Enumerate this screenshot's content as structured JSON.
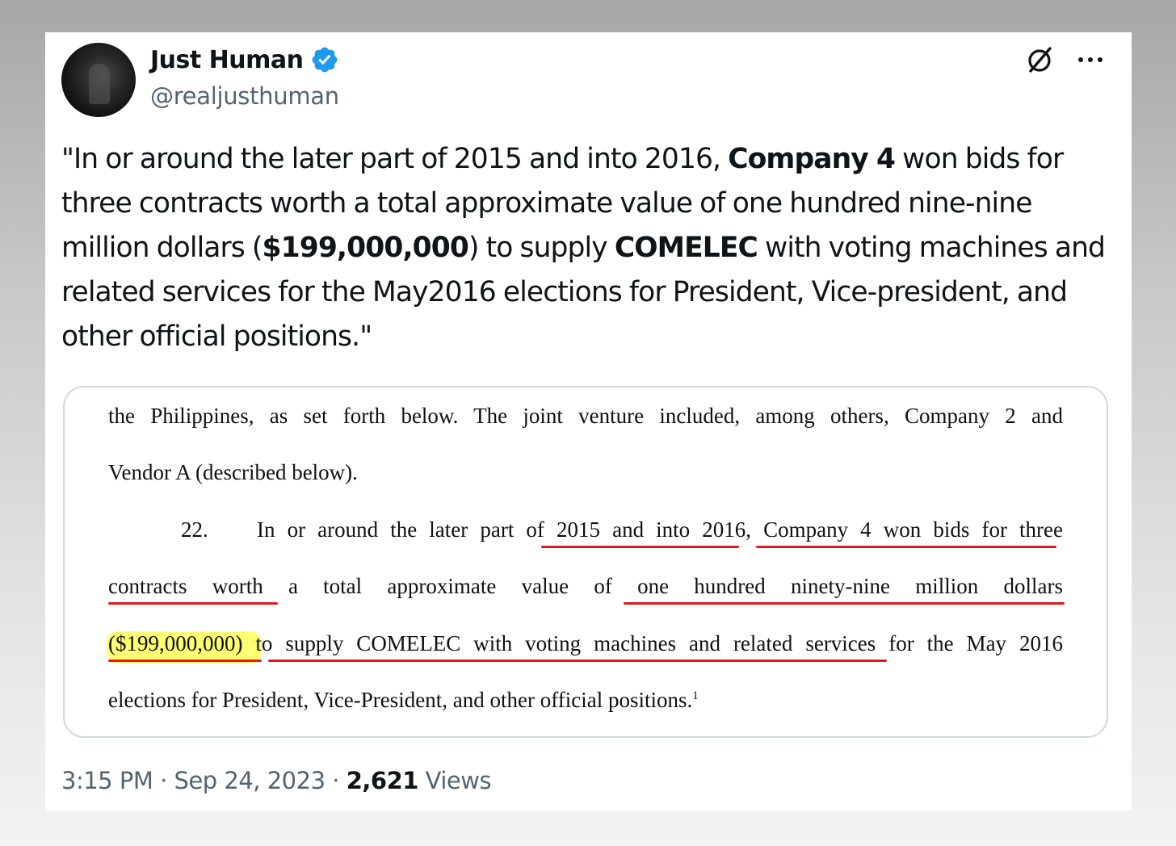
{
  "author": {
    "name": "Just Human",
    "handle": "@realjusthuman",
    "verified": true,
    "verified_color": "#1d9bf0"
  },
  "header_icons": [
    "grok-icon",
    "more-icon"
  ],
  "tweet": {
    "t1": "\"In or around the later part of 2015 and into 2016, ",
    "b1": "Company 4",
    "t2": " won bids for three contracts worth a total approximate value of one hundred nine-nine million dollars (",
    "b2": "$199,000,000",
    "t3": ") to supply ",
    "b3": "COMELEC",
    "t4": " with voting machines and related services for the May2016 elections for President, Vice-president, and other official positions.\""
  },
  "document_excerpt": {
    "line1": "the Philippines, as set forth below.  The joint venture included, among others, Company 2 and",
    "line2": "Vendor A (described below).",
    "para_num": "22.",
    "line3": "In or around the later part of 2015 and into 2016, Company 4 won bids for three",
    "line4": "contracts  worth  a  total  approximate  value  of  one  hundred  ninety-nine  million  dollars",
    "line5": "($199,000,000) to supply COMELEC with voting machines and related services for the May 2016",
    "line6": "elections for President, Vice-President, and other official positions.",
    "footnote": "1",
    "underline_color": "#e3161b",
    "highlight_color": "#ffff5a"
  },
  "footer": {
    "time": "3:15 PM",
    "date": "Sep 24, 2023",
    "views_count": "2,621",
    "views_label": "Views",
    "sep": "·"
  }
}
